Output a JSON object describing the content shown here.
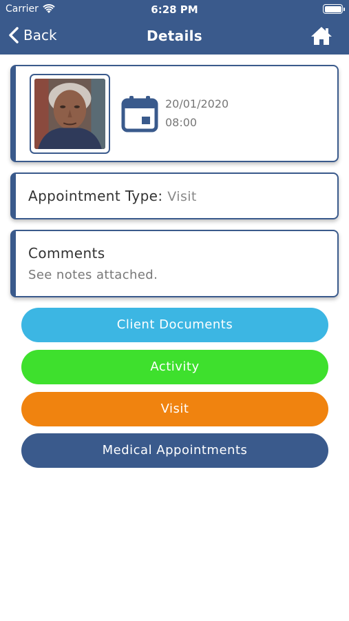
{
  "status_bar": {
    "carrier": "Carrier",
    "time": "6:28 PM"
  },
  "nav": {
    "back_label": "Back",
    "title": "Details"
  },
  "colors": {
    "primary": "#3a5a8c",
    "client_documents": "#3cb6e3",
    "activity": "#3ee02d",
    "visit": "#f0830f",
    "medical_appointments": "#3a5a8c"
  },
  "appointment": {
    "date": "20/01/2020",
    "time": "08:00",
    "type_label": "Appointment Type:",
    "type_value": "Visit"
  },
  "comments": {
    "title": "Comments",
    "text": "See notes attached."
  },
  "buttons": {
    "client_documents": "Client Documents",
    "activity": "Activity",
    "visit": "Visit",
    "medical_appointments": "Medical Appointments"
  },
  "icons": {
    "back": "chevron-left-icon",
    "home": "home-icon",
    "calendar": "calendar-icon",
    "wifi": "wifi-icon",
    "battery": "battery-icon"
  }
}
